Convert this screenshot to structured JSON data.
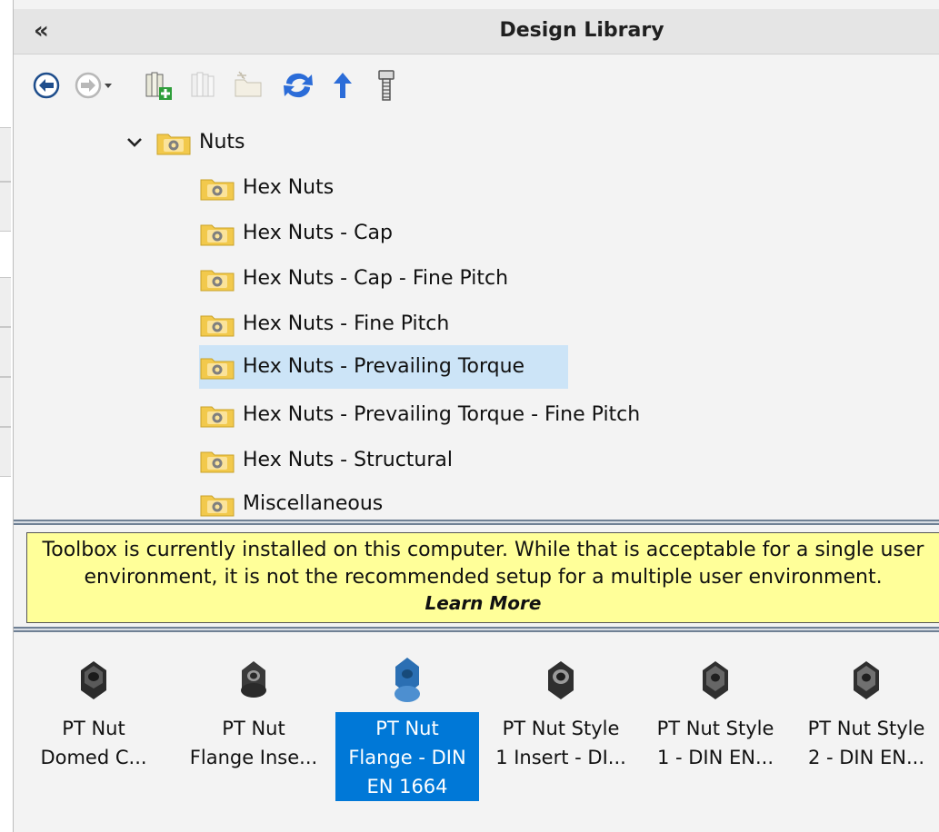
{
  "panel": {
    "title": "Design Library",
    "collapse_glyph": "«"
  },
  "toolbar": {
    "buttons": [
      {
        "icon": "back-icon"
      },
      {
        "icon": "forward-icon"
      },
      {
        "icon": "add-library-icon"
      },
      {
        "icon": "add-library-disabled-icon"
      },
      {
        "icon": "new-folder-icon"
      },
      {
        "icon": "refresh-icon"
      },
      {
        "icon": "up-folder-icon"
      },
      {
        "icon": "toolbox-bolt-icon"
      }
    ]
  },
  "tree": {
    "root": "Nuts",
    "items": [
      {
        "label": "Hex Nuts"
      },
      {
        "label": "Hex Nuts - Cap"
      },
      {
        "label": "Hex Nuts - Cap - Fine Pitch"
      },
      {
        "label": "Hex Nuts - Fine Pitch"
      },
      {
        "label": "Hex Nuts - Prevailing Torque",
        "selected": true
      },
      {
        "label": "Hex Nuts - Prevailing Torque - Fine Pitch"
      },
      {
        "label": "Hex Nuts - Structural"
      },
      {
        "label": "Miscellaneous"
      }
    ]
  },
  "warning": {
    "line1": "Toolbox is currently installed on this computer. While that is acceptable for a single user",
    "line2": "environment, it is not the recommended setup for a multiple user environment.",
    "link": "Learn More"
  },
  "gallery": {
    "items": [
      {
        "line1": "PT Nut",
        "line2": "Domed C..."
      },
      {
        "line1": "PT Nut",
        "line2": "Flange Inse..."
      },
      {
        "line1": "PT Nut",
        "line2": "Flange - DIN",
        "line3": "EN 1664",
        "selected": true
      },
      {
        "line1": "PT Nut Style",
        "line2": "1 Insert - DI..."
      },
      {
        "line1": "PT Nut Style",
        "line2": "1 - DIN EN..."
      },
      {
        "line1": "PT Nut Style",
        "line2": "2 - DIN EN..."
      }
    ]
  },
  "colors": {
    "selection_tree": "#cce4f7",
    "selection_gallery": "#0078d7",
    "warning_bg": "#ffff99",
    "folder": "#f2c94c"
  }
}
